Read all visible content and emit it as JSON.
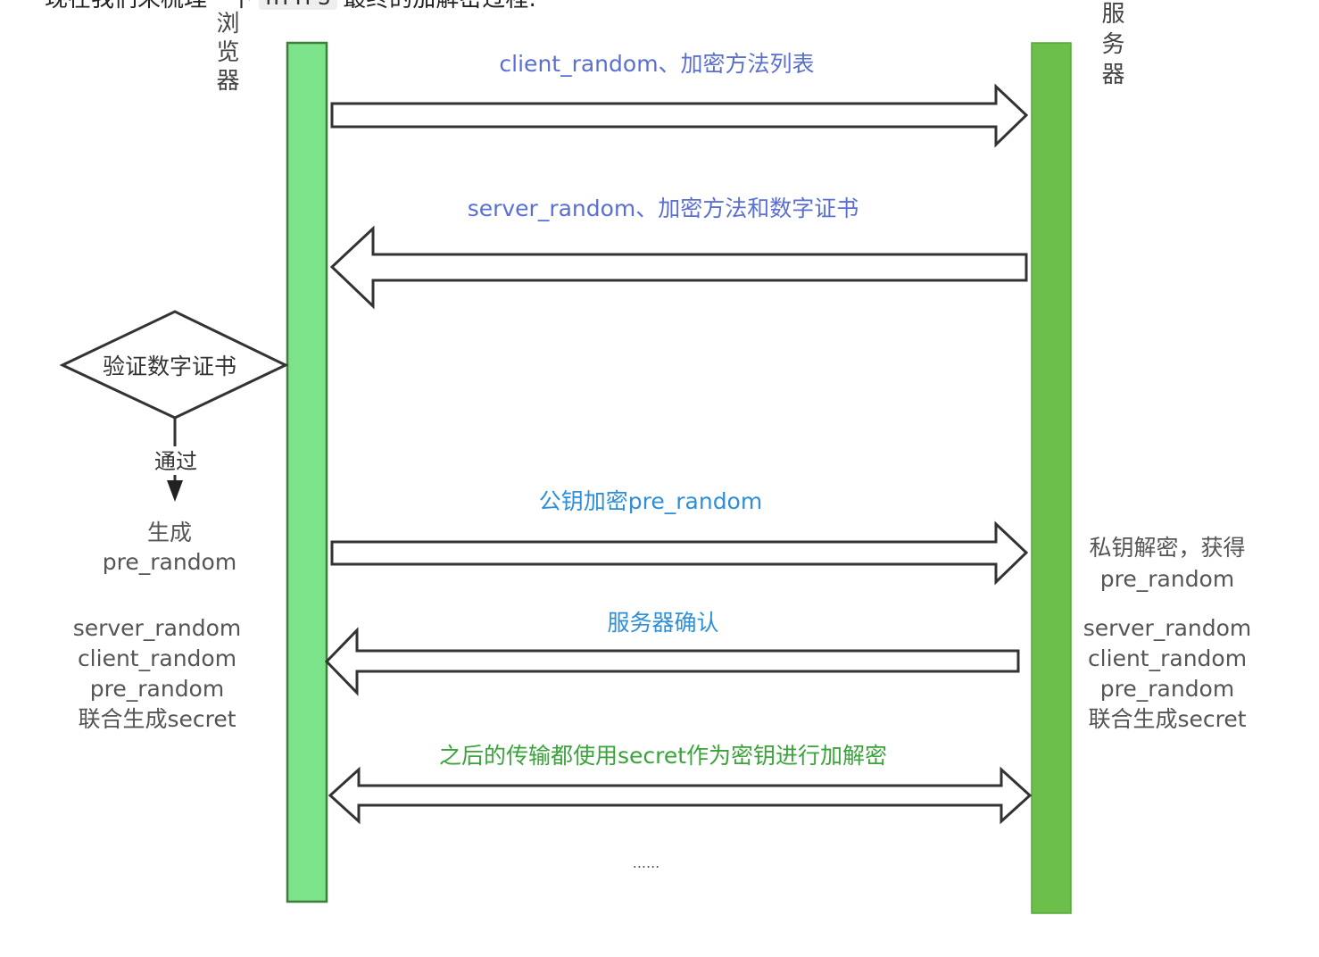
{
  "header_fragment": {
    "text_before": "现在我们来梳理一下",
    "code": "HTTPS",
    "text_after": "最终的加解密过程:"
  },
  "lifelines": {
    "browser": {
      "label": "浏览器",
      "color": "#7de38a"
    },
    "server": {
      "label": "服务器",
      "color": "#6bbf4a"
    }
  },
  "messages": [
    {
      "label": "client_random、加密方法列表",
      "direction": "right",
      "color": "#5b6fd1"
    },
    {
      "label": "server_random、加密方法和数字证书",
      "direction": "left",
      "color": "#5b6fd1"
    },
    {
      "label": "公钥加密pre_random",
      "direction": "right",
      "color": "#2f8fd6"
    },
    {
      "label": "服务器确认",
      "direction": "left",
      "color": "#2f8fd6"
    },
    {
      "label": "之后的传输都使用secret作为密钥进行加解密",
      "direction": "both",
      "color": "#3aa33a"
    }
  ],
  "browser_side": {
    "decision": "验证数字证书",
    "pass_label": "通过",
    "generate_line1": "生成",
    "generate_line2": "pre_random",
    "combine": [
      "server_random",
      "client_random",
      "pre_random",
      "联合生成secret"
    ]
  },
  "server_side": {
    "decrypt_line1": "私钥解密，获得",
    "decrypt_line2": "pre_random",
    "combine": [
      "server_random",
      "client_random",
      "pre_random",
      "联合生成secret"
    ]
  },
  "ellipsis": "......"
}
